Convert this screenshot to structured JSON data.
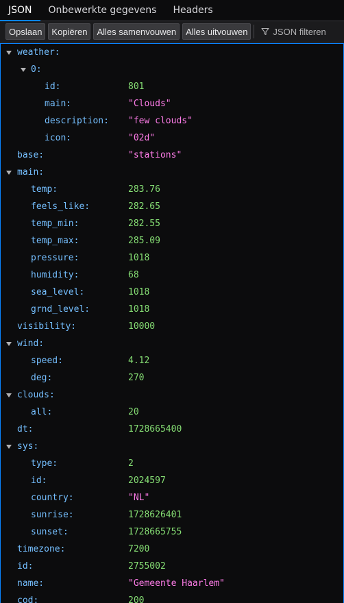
{
  "tabs": [
    {
      "label": "JSON",
      "active": true
    },
    {
      "label": "Onbewerkte gegevens",
      "active": false
    },
    {
      "label": "Headers",
      "active": false
    }
  ],
  "toolbar": {
    "save": "Opslaan",
    "copy": "Kopiëren",
    "collapse_all": "Alles samenvouwen",
    "expand_all": "Alles uitvouwen",
    "filter_placeholder": "JSON filteren"
  },
  "colors": {
    "key": "#75bfff",
    "number": "#86de74",
    "string": "#ff7de9",
    "accent": "#0a84ff"
  },
  "rows": [
    {
      "depth": 0,
      "key": "weather:",
      "value": "",
      "type": "object"
    },
    {
      "depth": 1,
      "key": "0:",
      "value": "",
      "type": "object"
    },
    {
      "depth": 2,
      "key": "id:",
      "value": "801",
      "type": "num"
    },
    {
      "depth": 2,
      "key": "main:",
      "value": "\"Clouds\"",
      "type": "str"
    },
    {
      "depth": 2,
      "key": "description:",
      "value": "\"few clouds\"",
      "type": "str"
    },
    {
      "depth": 2,
      "key": "icon:",
      "value": "\"02d\"",
      "type": "str"
    },
    {
      "depth": 0,
      "key": "base:",
      "value": "\"stations\"",
      "type": "str"
    },
    {
      "depth": 0,
      "key": "main:",
      "value": "",
      "type": "object"
    },
    {
      "depth": 1,
      "key": "temp:",
      "value": "283.76",
      "type": "num"
    },
    {
      "depth": 1,
      "key": "feels_like:",
      "value": "282.65",
      "type": "num"
    },
    {
      "depth": 1,
      "key": "temp_min:",
      "value": "282.55",
      "type": "num"
    },
    {
      "depth": 1,
      "key": "temp_max:",
      "value": "285.09",
      "type": "num"
    },
    {
      "depth": 1,
      "key": "pressure:",
      "value": "1018",
      "type": "num"
    },
    {
      "depth": 1,
      "key": "humidity:",
      "value": "68",
      "type": "num"
    },
    {
      "depth": 1,
      "key": "sea_level:",
      "value": "1018",
      "type": "num"
    },
    {
      "depth": 1,
      "key": "grnd_level:",
      "value": "1018",
      "type": "num"
    },
    {
      "depth": 0,
      "key": "visibility:",
      "value": "10000",
      "type": "num"
    },
    {
      "depth": 0,
      "key": "wind:",
      "value": "",
      "type": "object"
    },
    {
      "depth": 1,
      "key": "speed:",
      "value": "4.12",
      "type": "num"
    },
    {
      "depth": 1,
      "key": "deg:",
      "value": "270",
      "type": "num"
    },
    {
      "depth": 0,
      "key": "clouds:",
      "value": "",
      "type": "object"
    },
    {
      "depth": 1,
      "key": "all:",
      "value": "20",
      "type": "num"
    },
    {
      "depth": 0,
      "key": "dt:",
      "value": "1728665400",
      "type": "num"
    },
    {
      "depth": 0,
      "key": "sys:",
      "value": "",
      "type": "object"
    },
    {
      "depth": 1,
      "key": "type:",
      "value": "2",
      "type": "num"
    },
    {
      "depth": 1,
      "key": "id:",
      "value": "2024597",
      "type": "num"
    },
    {
      "depth": 1,
      "key": "country:",
      "value": "\"NL\"",
      "type": "str"
    },
    {
      "depth": 1,
      "key": "sunrise:",
      "value": "1728626401",
      "type": "num"
    },
    {
      "depth": 1,
      "key": "sunset:",
      "value": "1728665755",
      "type": "num"
    },
    {
      "depth": 0,
      "key": "timezone:",
      "value": "7200",
      "type": "num"
    },
    {
      "depth": 0,
      "key": "id:",
      "value": "2755002",
      "type": "num"
    },
    {
      "depth": 0,
      "key": "name:",
      "value": "\"Gemeente Haarlem\"",
      "type": "str"
    },
    {
      "depth": 0,
      "key": "cod:",
      "value": "200",
      "type": "num"
    }
  ]
}
